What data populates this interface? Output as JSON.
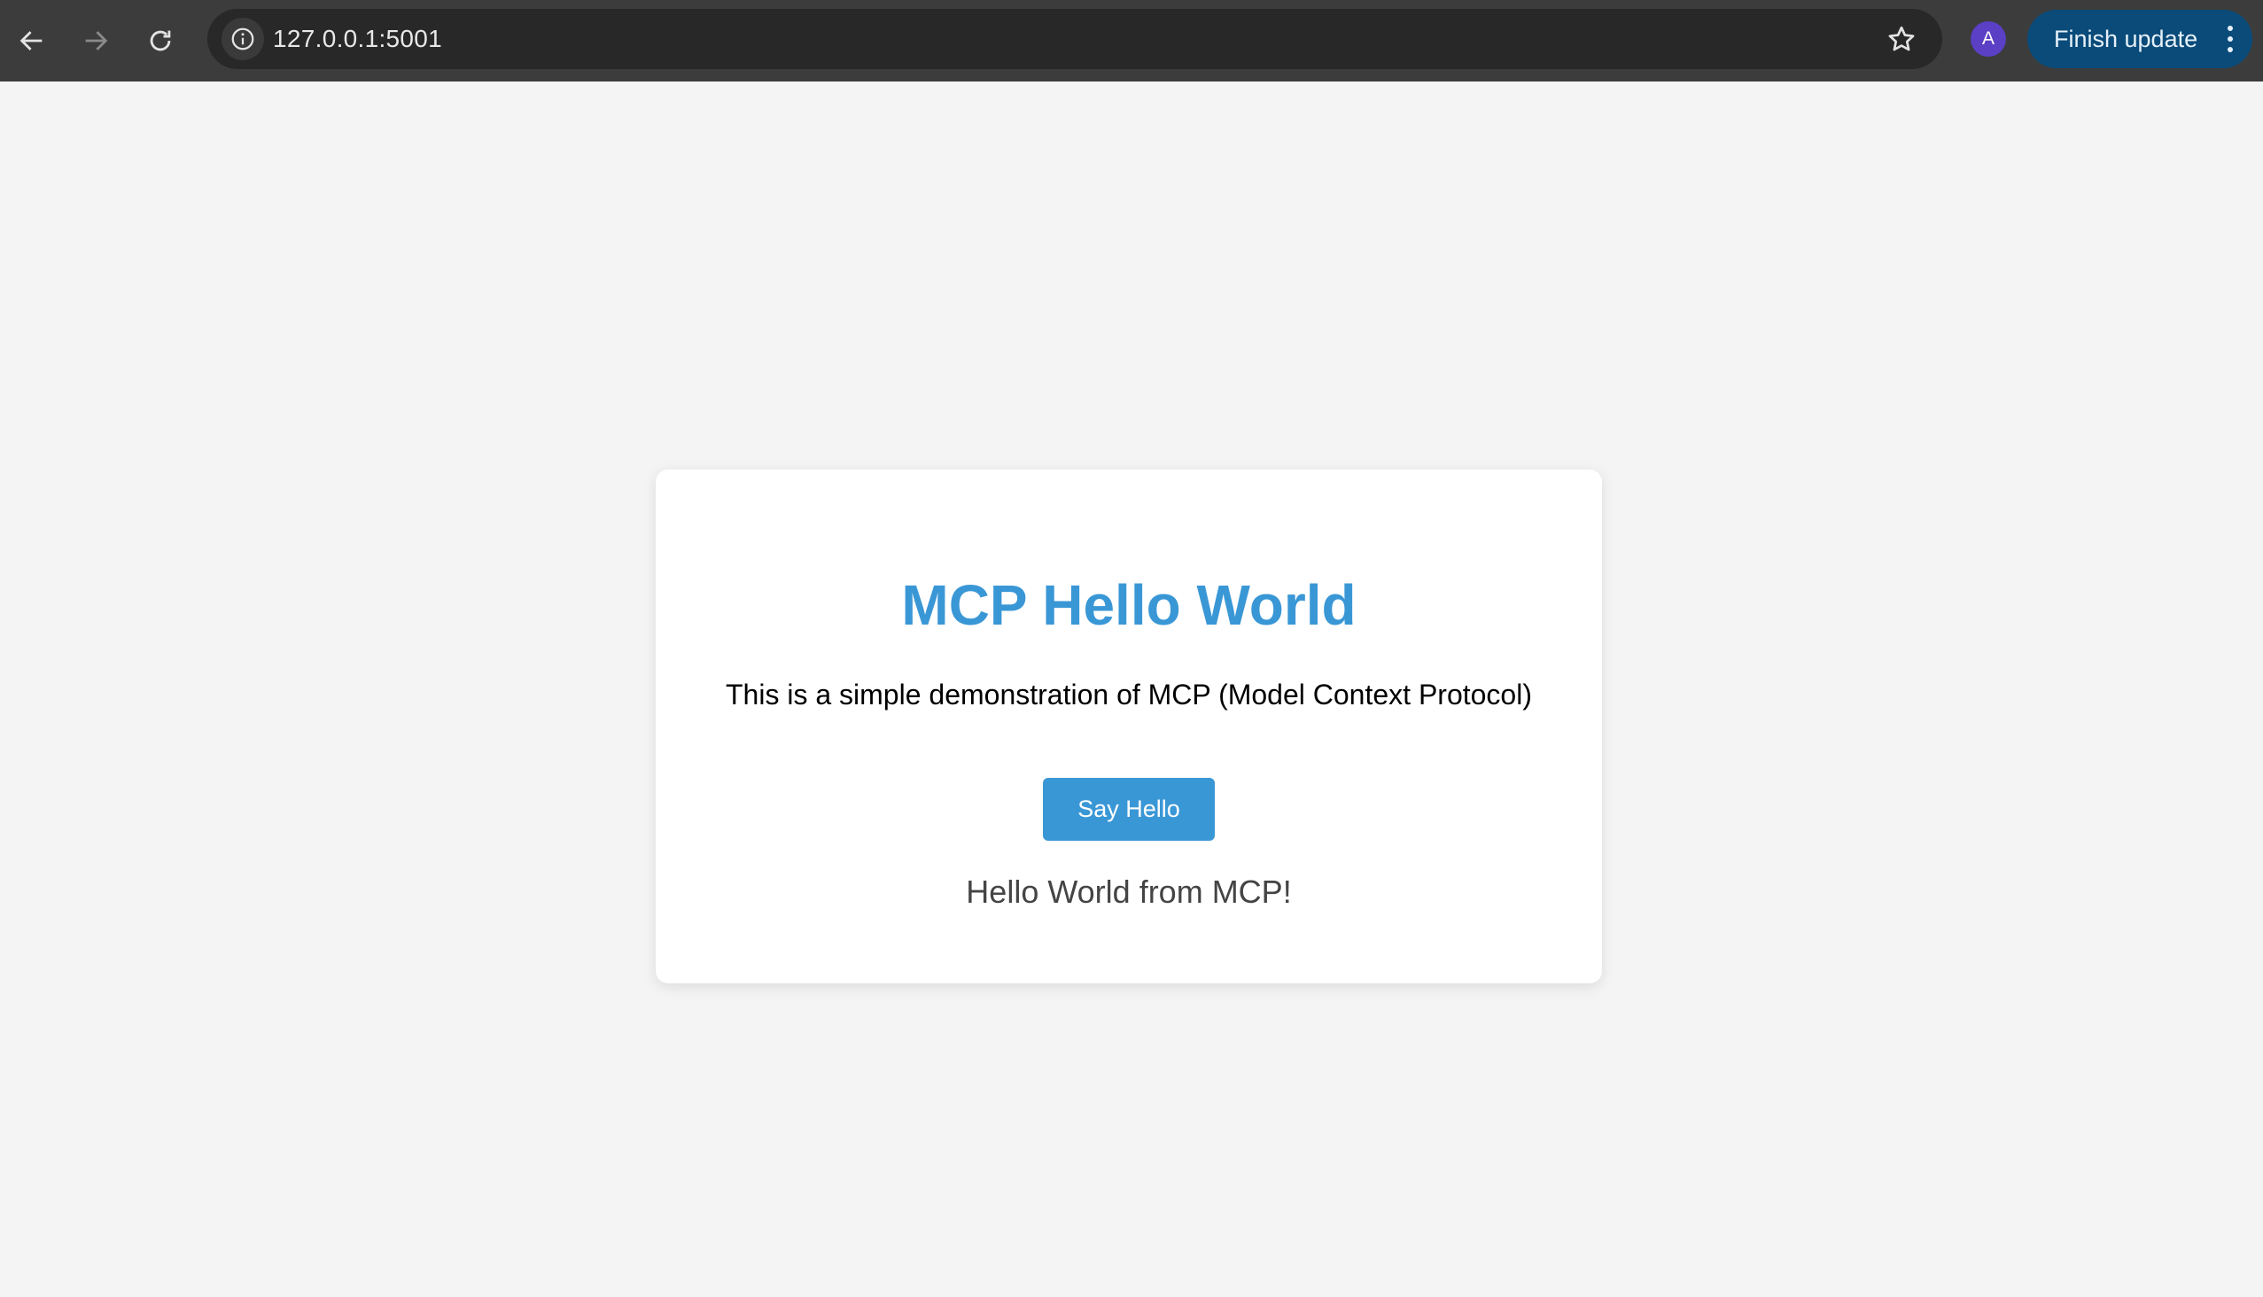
{
  "browser": {
    "url": "127.0.0.1:5001",
    "avatar_initial": "A",
    "finish_update_label": "Finish update",
    "icons": {
      "back": "back-arrow-icon",
      "forward": "forward-arrow-icon",
      "reload": "reload-icon",
      "site_info": "info-icon",
      "bookmark": "star-icon",
      "menu": "kebab-menu-icon"
    }
  },
  "page": {
    "title": "MCP Hello World",
    "description": "This is a simple demonstration of MCP (Model Context Protocol)",
    "button_label": "Say Hello",
    "result_text": "Hello World from MCP!"
  },
  "colors": {
    "accent": "#3a97d6",
    "page_background": "#f4f4f4",
    "toolbar": "#3c3c3c",
    "update_button": "#0a4b7a",
    "avatar": "#5b3fc4"
  }
}
